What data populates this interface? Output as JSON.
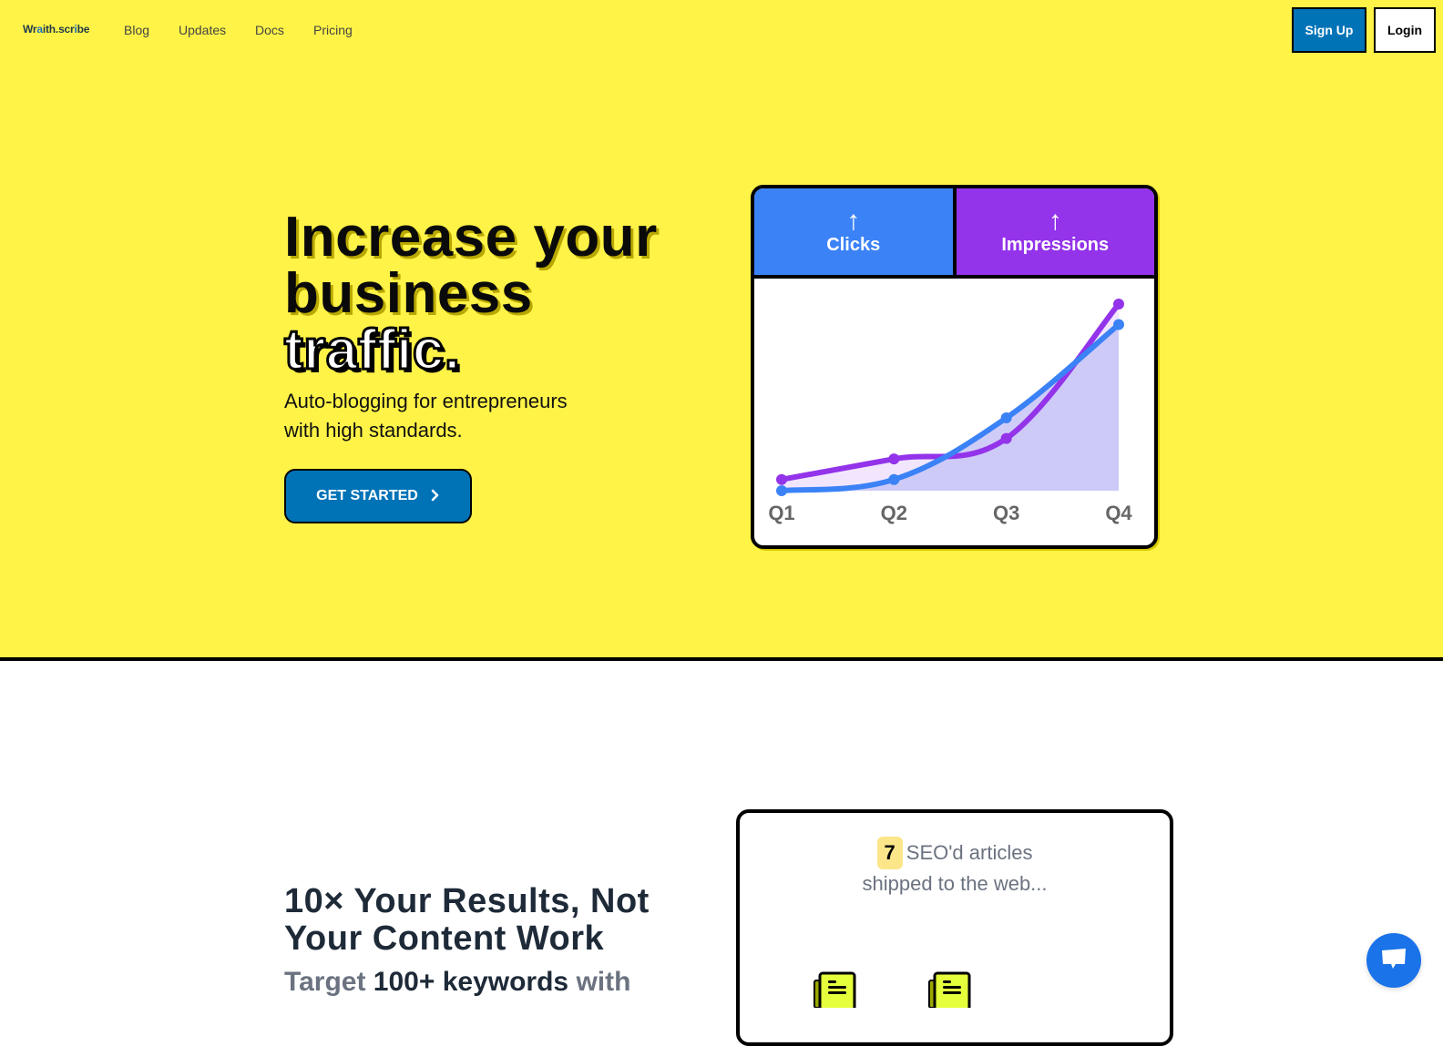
{
  "nav": {
    "logo": {
      "prefix": "Wr",
      "accent1": "a",
      "mid": "ith.scr",
      "accent2": "i",
      "suffix": "be"
    },
    "links": [
      "Blog",
      "Updates",
      "Docs",
      "Pricing"
    ],
    "signup_label": "Sign Up",
    "login_label": "Login"
  },
  "hero": {
    "headline_lines": [
      "Increase your",
      "business"
    ],
    "headline_highlight": "traffic.",
    "subtitle_lines": [
      "Auto-blogging for entrepreneurs",
      "with high standards."
    ],
    "cta_label": "GET STARTED",
    "cta_icon": "chevron-right-icon"
  },
  "chart_card": {
    "tabs": [
      {
        "arrow": "↑",
        "label": "Clicks",
        "color": "#3b82f6"
      },
      {
        "arrow": "↑",
        "label": "Impressions",
        "color": "#9333ea"
      }
    ]
  },
  "chart_data": {
    "type": "line",
    "title": "",
    "xlabel": "",
    "ylabel": "",
    "categories": [
      "Q1",
      "Q2",
      "Q3",
      "Q4"
    ],
    "ylim": [
      0,
      100
    ],
    "grid": false,
    "legend": "top",
    "series": [
      {
        "name": "Impressions",
        "color": "#9333ea",
        "fill": "#e9d5ff",
        "values": [
          6,
          17,
          28,
          100
        ]
      },
      {
        "name": "Clicks",
        "color": "#3b82f6",
        "fill": "#c7c4f7",
        "values": [
          0,
          6,
          39,
          89
        ]
      }
    ]
  },
  "results": {
    "heading_lines": [
      "10× Your Results, Not",
      "Your Content Work"
    ],
    "sub_parts": {
      "pre": "Target ",
      "emph": "100+ keywords",
      "post": " with"
    }
  },
  "articles_card": {
    "count": "7",
    "text_line1": "SEO'd articles",
    "text_line2": "shipped to the web...",
    "icon_color": "#e6ff3c"
  },
  "chat": {
    "icon": "chat-bubble-icon",
    "color": "#1a73e8"
  }
}
